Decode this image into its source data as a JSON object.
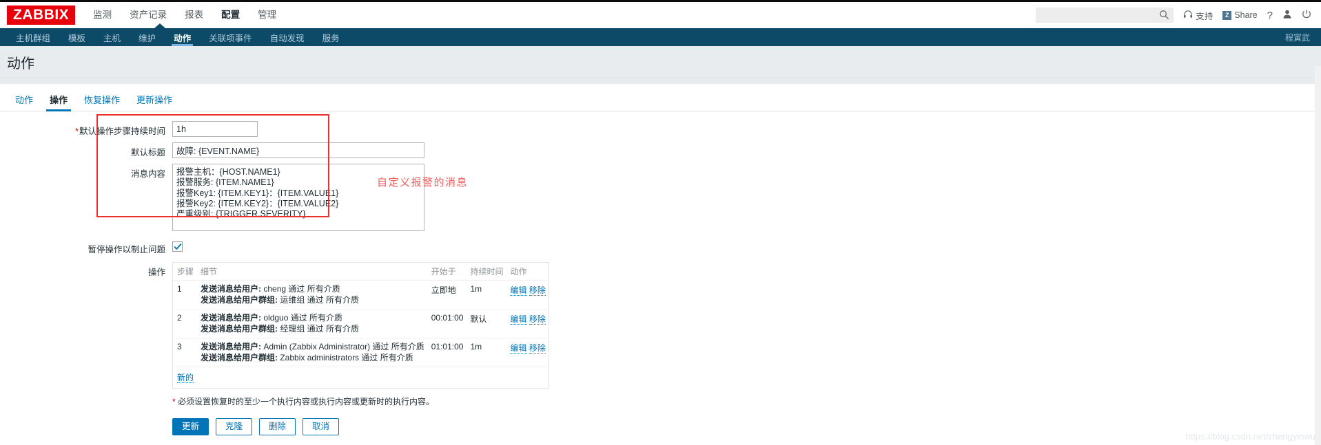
{
  "brand": {
    "logo": "ZABBIX",
    "logo_color": "#e8000b"
  },
  "header": {
    "nav": [
      {
        "label": "监测",
        "selected": false
      },
      {
        "label": "资产记录",
        "selected": false
      },
      {
        "label": "报表",
        "selected": false
      },
      {
        "label": "配置",
        "selected": true
      },
      {
        "label": "管理",
        "selected": false
      }
    ],
    "search": {
      "value": "",
      "placeholder": "",
      "icon": "search-icon"
    },
    "support_label": "支持",
    "share_label": "Share",
    "share_badge": "Z",
    "help_label": "?",
    "user_icon": "user-icon",
    "signout_icon": "power-icon"
  },
  "subnav": {
    "items": [
      {
        "label": "主机群组",
        "selected": false
      },
      {
        "label": "模板",
        "selected": false
      },
      {
        "label": "主机",
        "selected": false
      },
      {
        "label": "维护",
        "selected": false
      },
      {
        "label": "动作",
        "selected": true
      },
      {
        "label": "关联项事件",
        "selected": false
      },
      {
        "label": "自动发现",
        "selected": false
      },
      {
        "label": "服务",
        "selected": false
      }
    ],
    "user": "程寅武"
  },
  "page": {
    "title": "动作"
  },
  "tabs": [
    {
      "label": "动作",
      "selected": false
    },
    {
      "label": "操作",
      "selected": true
    },
    {
      "label": "恢复操作",
      "selected": false
    },
    {
      "label": "更新操作",
      "selected": false
    }
  ],
  "form": {
    "default_step_duration": {
      "label": "默认操作步骤持续时间",
      "required": true,
      "value": "1h"
    },
    "default_subject": {
      "label": "默认标题",
      "value": "故障: {EVENT.NAME}"
    },
    "message_body": {
      "label": "消息内容",
      "value": "报警主机：{HOST.NAME1}\n报警服务: {ITEM.NAME1}\n报警Key1: {ITEM.KEY1}：{ITEM.VALUE1}\n报警Key2: {ITEM.KEY2}：{ITEM.VALUE2}\n严重级别: {TRIGGER.SEVERITY}"
    },
    "pause_suppressed": {
      "label": "暂停操作以制止问题",
      "checked": true
    },
    "operations_label": "操作"
  },
  "annotation": {
    "text": "自定义报警的消息",
    "color": "#f45a5a",
    "box_color": "#ef2e2e"
  },
  "operations_table": {
    "headers": {
      "step": "步骤",
      "details": "细节",
      "start_in": "开始于",
      "duration": "持续时间",
      "action": "动作"
    },
    "rows": [
      {
        "step": "1",
        "detail_lines": [
          {
            "bold": "发送消息给用户:",
            "rest": " cheng 通过 所有介质"
          },
          {
            "bold": "发送消息给用户群组:",
            "rest": " 运维组 通过 所有介质"
          }
        ],
        "start_in": "立即地",
        "duration": "1m",
        "edit_label": "编辑",
        "remove_label": "移除"
      },
      {
        "step": "2",
        "detail_lines": [
          {
            "bold": "发送消息给用户:",
            "rest": " oldguo 通过 所有介质"
          },
          {
            "bold": "发送消息给用户群组:",
            "rest": " 经理组 通过 所有介质"
          }
        ],
        "start_in": "00:01:00",
        "duration": "默认",
        "edit_label": "编辑",
        "remove_label": "移除"
      },
      {
        "step": "3",
        "detail_lines": [
          {
            "bold": "发送消息给用户:",
            "rest": " Admin (Zabbix Administrator) 通过 所有介质"
          },
          {
            "bold": "发送消息给用户群组:",
            "rest": " Zabbix administrators 通过 所有介质"
          }
        ],
        "start_in": "01:01:00",
        "duration": "1m",
        "edit_label": "编辑",
        "remove_label": "移除"
      }
    ],
    "new_label": "新的"
  },
  "footnote": {
    "star": "*",
    "text": " 必须设置恢复时的至少一个执行内容或执行内容或更新时的执行内容。"
  },
  "buttons": {
    "update": "更新",
    "clone": "克隆",
    "delete": "删除",
    "cancel": "取消"
  },
  "watermark": "https://blog.csdn.net/chengyinwu"
}
